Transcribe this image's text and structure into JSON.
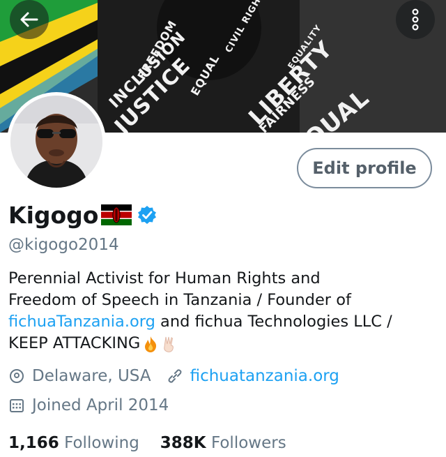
{
  "banner": {
    "words": [
      "FREEDOM",
      "INCLUSION",
      "JUSTICE",
      "EQUAL",
      "LIBERTY",
      "FAIRNESS",
      "CIVIL RIGHTS",
      "EQUALITY",
      "QUAL"
    ]
  },
  "header": {
    "back_icon": "arrow-left-icon",
    "more_icon": "more-vertical-icon"
  },
  "profile": {
    "edit_button": "Edit profile",
    "name": "Kigogo",
    "handle": "@kigogo2014",
    "bio": {
      "line1": "Perennial Activist for Human Rights and",
      "line2": "Freedom of Speech in Tanzania / Founder of",
      "link": "fichuaTanzania.org",
      "line3_rest": " and fichua Technologies LLC /",
      "line4": "KEEP ATTACKING"
    },
    "location": "Delaware, USA",
    "website": "fichuatanzania.org",
    "joined": "Joined April 2014",
    "following_count": "1,166",
    "following_label": "Following",
    "followers_count": "388K",
    "followers_label": "Followers"
  },
  "colors": {
    "link": "#1da1f2",
    "muted": "#657786",
    "verified": "#1da1f2"
  }
}
